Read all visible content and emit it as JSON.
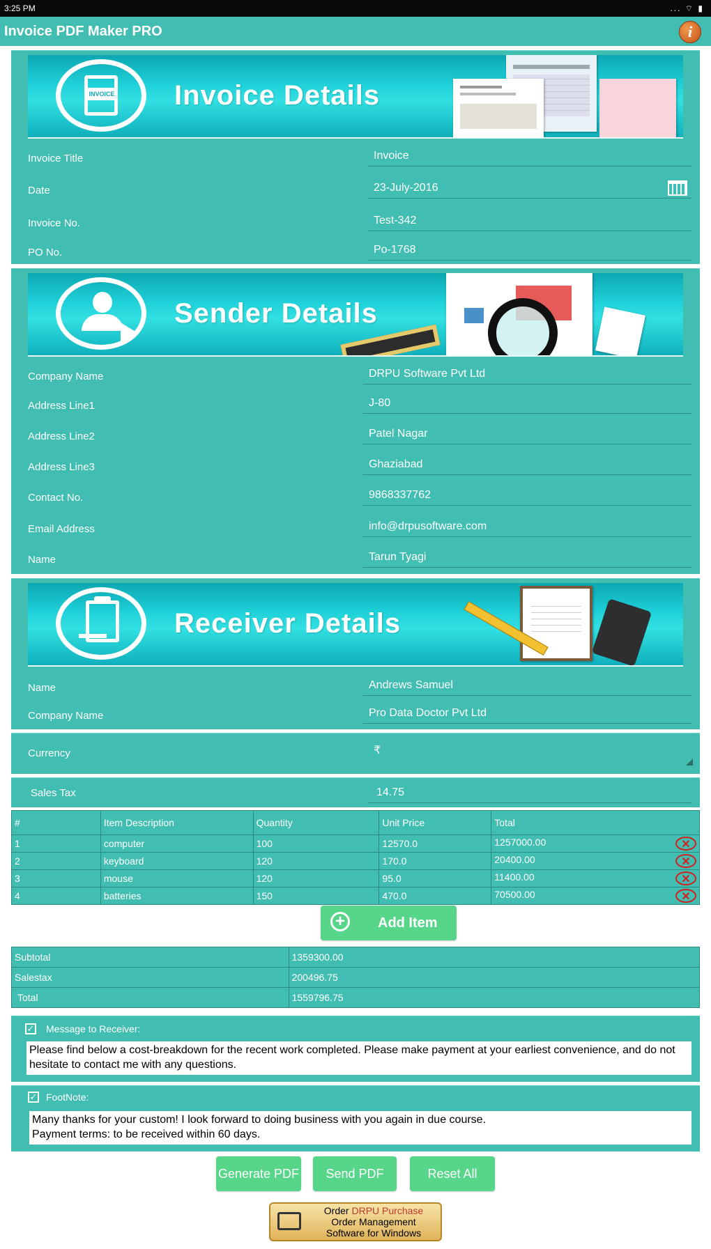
{
  "statusbar": {
    "time": "3:25 PM",
    "icons": "... ⌔ ▮"
  },
  "app": {
    "title": "Invoice PDF Maker PRO",
    "info_icon": "i"
  },
  "invoice": {
    "banner_title": "Invoice Details",
    "badge": "INVOICE",
    "fields": [
      {
        "label": "Invoice Title",
        "value": "Invoice"
      },
      {
        "label": "Date",
        "value": "23-July-2016"
      },
      {
        "label": "Invoice No.",
        "value": "Test-342"
      },
      {
        "label": "PO No.",
        "value": "Po-1768"
      }
    ]
  },
  "sender": {
    "banner_title": "Sender Details",
    "fields": [
      {
        "label": "Company Name",
        "value": "DRPU Software Pvt Ltd"
      },
      {
        "label": "Address Line1",
        "value": "J-80"
      },
      {
        "label": "Address Line2",
        "value": "Patel Nagar"
      },
      {
        "label": "Address Line3",
        "value": "Ghaziabad"
      },
      {
        "label": "Contact No.",
        "value": "9868337762"
      },
      {
        "label": "Email Address",
        "value": "info@drpusoftware.com"
      },
      {
        "label": "Name",
        "value": "Tarun Tyagi"
      }
    ]
  },
  "receiver": {
    "banner_title": "Receiver Details",
    "fields": [
      {
        "label": "Name",
        "value": "Andrews Samuel"
      },
      {
        "label": "Company Name",
        "value": "Pro Data Doctor Pvt Ltd"
      }
    ]
  },
  "currency": {
    "label": "Currency",
    "value": "₹"
  },
  "sales_tax": {
    "label": "Sales Tax",
    "value": "14.75"
  },
  "items_table": {
    "headers": [
      "#",
      "Item Description",
      "Quantity",
      "Unit Price",
      "Total"
    ],
    "rows": [
      [
        "1",
        "computer",
        "100",
        "12570.0",
        "1257000.00"
      ],
      [
        "2",
        "keyboard",
        "120",
        "170.0",
        "20400.00"
      ],
      [
        "3",
        "mouse",
        "120",
        "95.0",
        "11400.00"
      ],
      [
        "4",
        "batteries",
        "150",
        "470.0",
        "70500.00"
      ]
    ]
  },
  "add_item": {
    "label": "Add Item"
  },
  "totals": {
    "rows": [
      {
        "label": "Subtotal",
        "value": "1359300.00"
      },
      {
        "label": "Salestax",
        "value": "200496.75"
      },
      {
        "label": "Total",
        "value": "1559796.75"
      }
    ]
  },
  "message": {
    "label": "Message to Receiver:",
    "checked": true,
    "text": "Please find below a cost-breakdown for the recent work completed. Please make payment at your earliest convenience, and do not hesitate to contact me with any questions."
  },
  "footnote": {
    "label": "FootNote:",
    "checked": true,
    "line1": "Many thanks for your custom! I look forward to doing business with you again in due course.",
    "line2": "Payment terms: to be received within 60 days."
  },
  "actions": {
    "generate": "Generate PDF",
    "send": "Send PDF",
    "reset": "Reset All"
  },
  "ad": {
    "line1_a": "Order ",
    "line1_b": "DRPU Purchase",
    "line2": "Order Management",
    "line3": "Software for Windows"
  },
  "colors": {
    "teal": "#41beb1",
    "green_button": "#57d68a",
    "delete_red": "#d32020"
  }
}
